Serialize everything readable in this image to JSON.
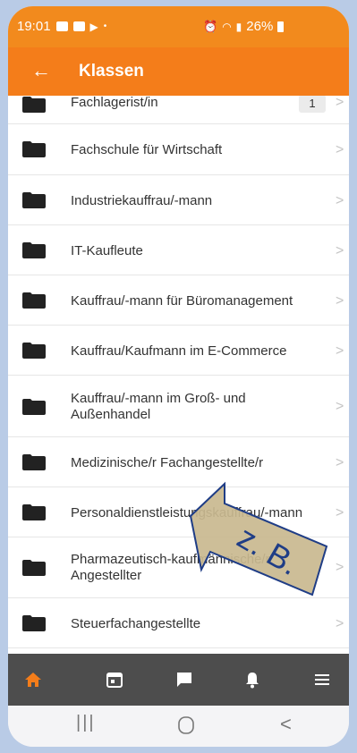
{
  "status": {
    "time": "19:01",
    "battery": "26%"
  },
  "appbar": {
    "title": "Klassen"
  },
  "list": {
    "items": [
      {
        "label": "Fachlagerist/in",
        "count": "1"
      },
      {
        "label": "Fachschule für Wirtschaft"
      },
      {
        "label": "Industriekauffrau/-mann"
      },
      {
        "label": "IT-Kaufleute"
      },
      {
        "label": "Kauffrau/-mann für Büromanagement"
      },
      {
        "label": "Kauffrau/Kaufmann im E-Commerce"
      },
      {
        "label": "Kauffrau/-mann im Groß- und Außenhandel"
      },
      {
        "label": "Medizinische/r Fachangestellte/r"
      },
      {
        "label": "Personaldienstleistungskauffrau/-mann"
      },
      {
        "label": "Pharmazeutisch-kaufmännische/r Angestellter"
      },
      {
        "label": "Steuerfachangestellte"
      }
    ]
  },
  "annotation": {
    "text": "z. B."
  },
  "colors": {
    "accent": "#f47d1a",
    "nav_bg": "#4d4d4d",
    "active_icon": "#f47d1a"
  }
}
